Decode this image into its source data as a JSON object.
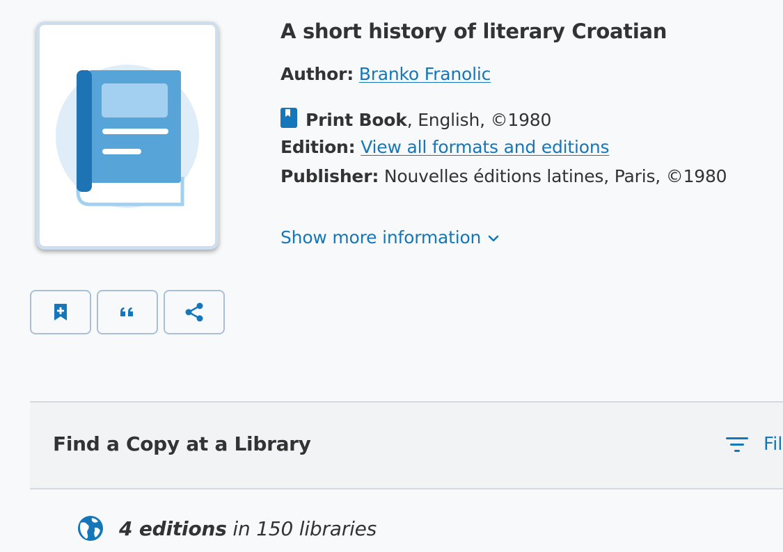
{
  "book": {
    "title": "A short history of literary Croatian",
    "author_label": "Author:",
    "author_name": "Branko Franolic",
    "format_bold": "Print Book",
    "format_rest": ", English, ©1980",
    "edition_label": "Edition:",
    "edition_link": "View all formats and editions",
    "publisher_label": "Publisher:",
    "publisher_value": "Nouvelles éditions latines, Paris, ©1980",
    "show_more": "Show more information"
  },
  "actions": {
    "save_icon": "bookmark-plus-icon",
    "cite_icon": "quote-icon",
    "share_icon": "share-icon"
  },
  "find_copy": {
    "title": "Find a Copy at a Library",
    "filter_label": "Fil",
    "editions_count": "4 editions",
    "editions_rest": " in 150 libraries"
  },
  "colors": {
    "accent": "#1577b9",
    "cover_book": "#56a4d8",
    "cover_spine": "#1e73b4",
    "cover_circle": "#dfedf9",
    "band_bg": "#f1f3f5"
  }
}
